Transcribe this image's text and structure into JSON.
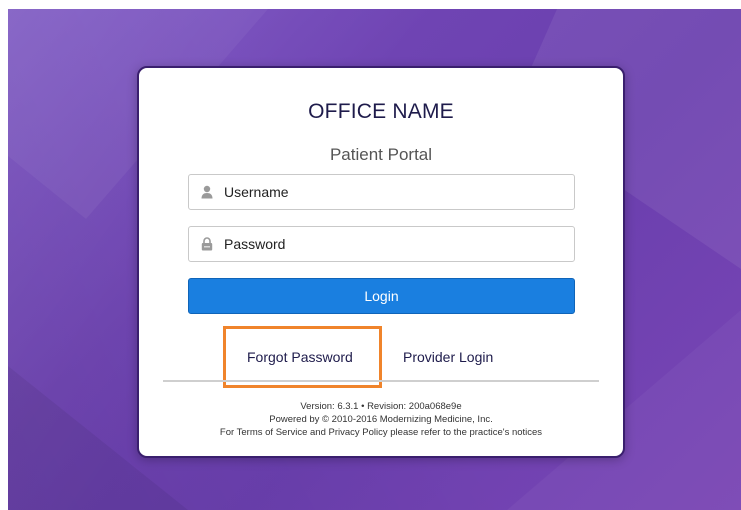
{
  "office_name": "OFFICE NAME",
  "portal_title": "Patient Portal",
  "username": {
    "placeholder": "Username",
    "value": "",
    "icon": "user-icon"
  },
  "password": {
    "placeholder": "Password",
    "value": "",
    "icon": "lock-icon"
  },
  "login_button": "Login",
  "links": {
    "forgot_password": "Forgot Password",
    "provider_login": "Provider Login"
  },
  "footer": {
    "version": "Version: 6.3.1 • Revision: 200a068e9e",
    "powered_by": "Powered by © 2010-2016 Modernizing Medicine, Inc.",
    "terms": "For Terms of Service and Privacy Policy please refer to the practice's notices"
  },
  "colors": {
    "background_purple": "#6f44b3",
    "login_button": "#1a7fe0",
    "highlight_orange": "#f0842b",
    "card_border": "#3a1f6e"
  }
}
